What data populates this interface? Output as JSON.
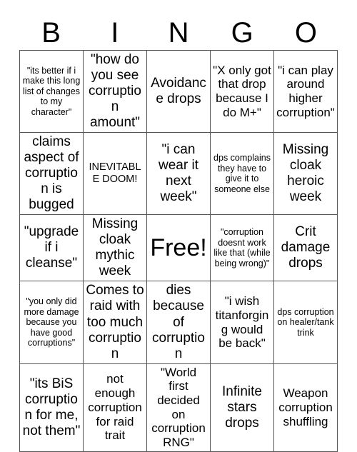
{
  "page": {
    "title": "BINGO",
    "background_color": "#ffffff",
    "text_color": "#000000",
    "border_color": "#555555"
  },
  "header": {
    "letters": [
      "B",
      "I",
      "N",
      "G",
      "O"
    ]
  },
  "grid": {
    "columns": 5,
    "rows": 5,
    "free_space": {
      "row": 2,
      "col": 2,
      "label": "Free!"
    },
    "cells": [
      [
        {
          "text": "\"its better if i make this long list of changes to my character\"",
          "size": "xs"
        },
        {
          "text": "\"how do you see corruption amount\"",
          "size": "lg"
        },
        {
          "text": "Avoidance drops",
          "size": "lg"
        },
        {
          "text": "\"X only got that drop because I do M+\"",
          "size": "md"
        },
        {
          "text": "\"i can play around higher corruption\"",
          "size": "md"
        }
      ],
      [
        {
          "text": "claims aspect of corruption is bugged",
          "size": "lg"
        },
        {
          "text": "INEVITABLE DOOM!",
          "size": "sm"
        },
        {
          "text": "\"i can wear it next week\"",
          "size": "lg"
        },
        {
          "text": "dps complains they have to give it to someone else",
          "size": "xs"
        },
        {
          "text": "Missing cloak heroic week",
          "size": "lg"
        }
      ],
      [
        {
          "text": "\"upgrade if i cleanse\"",
          "size": "lg"
        },
        {
          "text": "Missing cloak mythic week",
          "size": "lg"
        },
        {
          "text": "Free!",
          "size": "xl"
        },
        {
          "text": "\"corruption doesnt work like that (while being wrong)\"",
          "size": "xs"
        },
        {
          "text": "Crit damage drops",
          "size": "lg"
        }
      ],
      [
        {
          "text": "\"you only did more damage because you have good corruptions\"",
          "size": "xs"
        },
        {
          "text": "Comes to raid with too much corruption",
          "size": "lg"
        },
        {
          "text": "dies because of corruption",
          "size": "lg"
        },
        {
          "text": "\"i wish titanforging would be back\"",
          "size": "md"
        },
        {
          "text": "dps corruption on healer/tank trink",
          "size": "xs"
        }
      ],
      [
        {
          "text": "\"its BiS corruption for me, not them\"",
          "size": "lg"
        },
        {
          "text": "not enough corruption for raid trait",
          "size": "md"
        },
        {
          "text": "\"World first decided on corruption RNG\"",
          "size": "md"
        },
        {
          "text": "Infinite stars drops",
          "size": "lg"
        },
        {
          "text": "Weapon corruption shuffling",
          "size": "md"
        }
      ]
    ]
  }
}
